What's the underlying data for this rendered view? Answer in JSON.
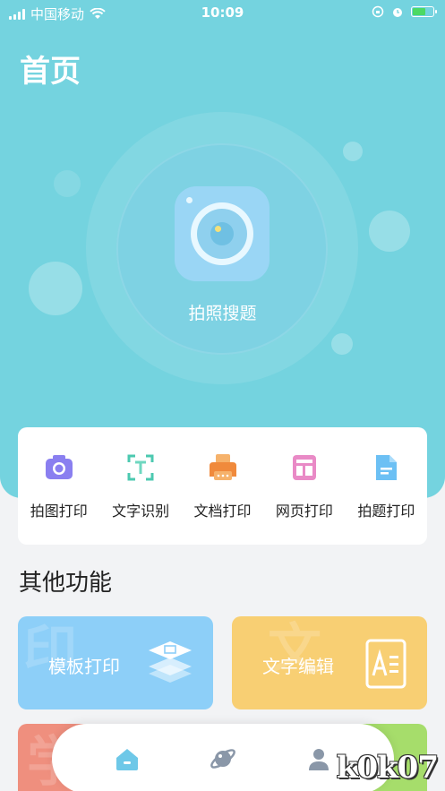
{
  "status_bar": {
    "carrier": "中国移动",
    "time": "10:09"
  },
  "page_title": "首页",
  "hero": {
    "action_label": "拍照搜题",
    "icon": "camera-lens-icon"
  },
  "quick_actions": [
    {
      "label": "拍图打印",
      "icon": "camera-icon",
      "color": "#7a6ee0"
    },
    {
      "label": "文字识别",
      "icon": "text-scan-icon",
      "color": "#4cc9b0"
    },
    {
      "label": "文档打印",
      "icon": "printer-icon",
      "color": "#f08a3c"
    },
    {
      "label": "网页打印",
      "icon": "webpage-icon",
      "color": "#e572b8"
    },
    {
      "label": "拍题打印",
      "icon": "document-icon",
      "color": "#5ab4f0"
    }
  ],
  "other_section": {
    "title": "其他功能",
    "tiles": [
      {
        "label": "模板打印",
        "icon": "template-stack-icon",
        "color": "#8dcff8"
      },
      {
        "label": "文字编辑",
        "icon": "text-edit-icon",
        "color": "#f8cf73"
      }
    ]
  },
  "tab_bar": {
    "tabs": [
      {
        "name": "home",
        "icon": "home-icon",
        "active": true
      },
      {
        "name": "discover",
        "icon": "planet-icon",
        "active": false
      },
      {
        "name": "profile",
        "icon": "user-icon",
        "active": false
      }
    ]
  },
  "watermark": "k0k07"
}
